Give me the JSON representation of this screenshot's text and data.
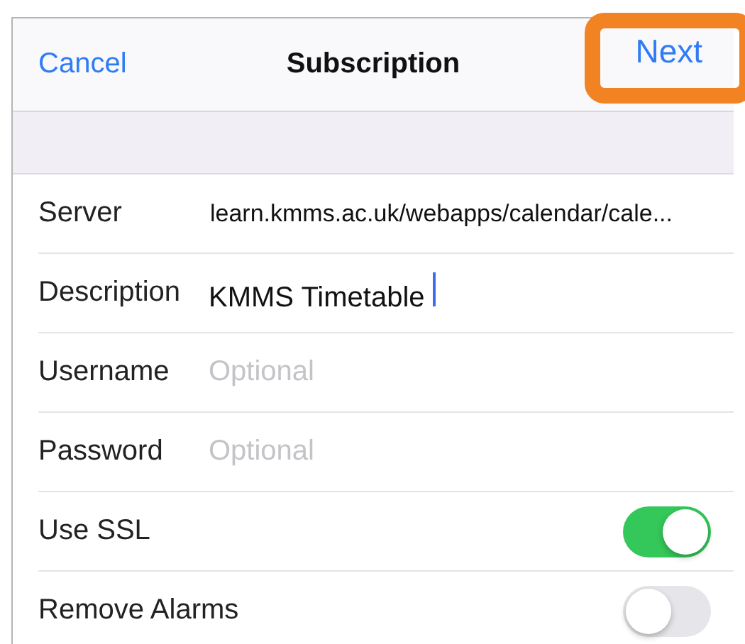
{
  "nav_bar": {
    "cancel": "Cancel",
    "title": "Subscription",
    "next": "Next",
    "next_highlighted": true
  },
  "rows": [
    {
      "kind": "text",
      "label": "Server",
      "value": "learn.kmms.ac.uk/webapps/calendar/cale...",
      "focused": false
    },
    {
      "kind": "text",
      "label": "Description",
      "value": "KMMS Timetable",
      "focused": true
    },
    {
      "kind": "text",
      "label": "Username",
      "placeholder": "Optional",
      "focused": false
    },
    {
      "kind": "text",
      "label": "Password",
      "placeholder": "Optional",
      "focused": false
    },
    {
      "kind": "toggle",
      "label": "Use SSL",
      "on": true
    },
    {
      "kind": "toggle",
      "label": "Remove Alarms",
      "on": false
    }
  ]
}
